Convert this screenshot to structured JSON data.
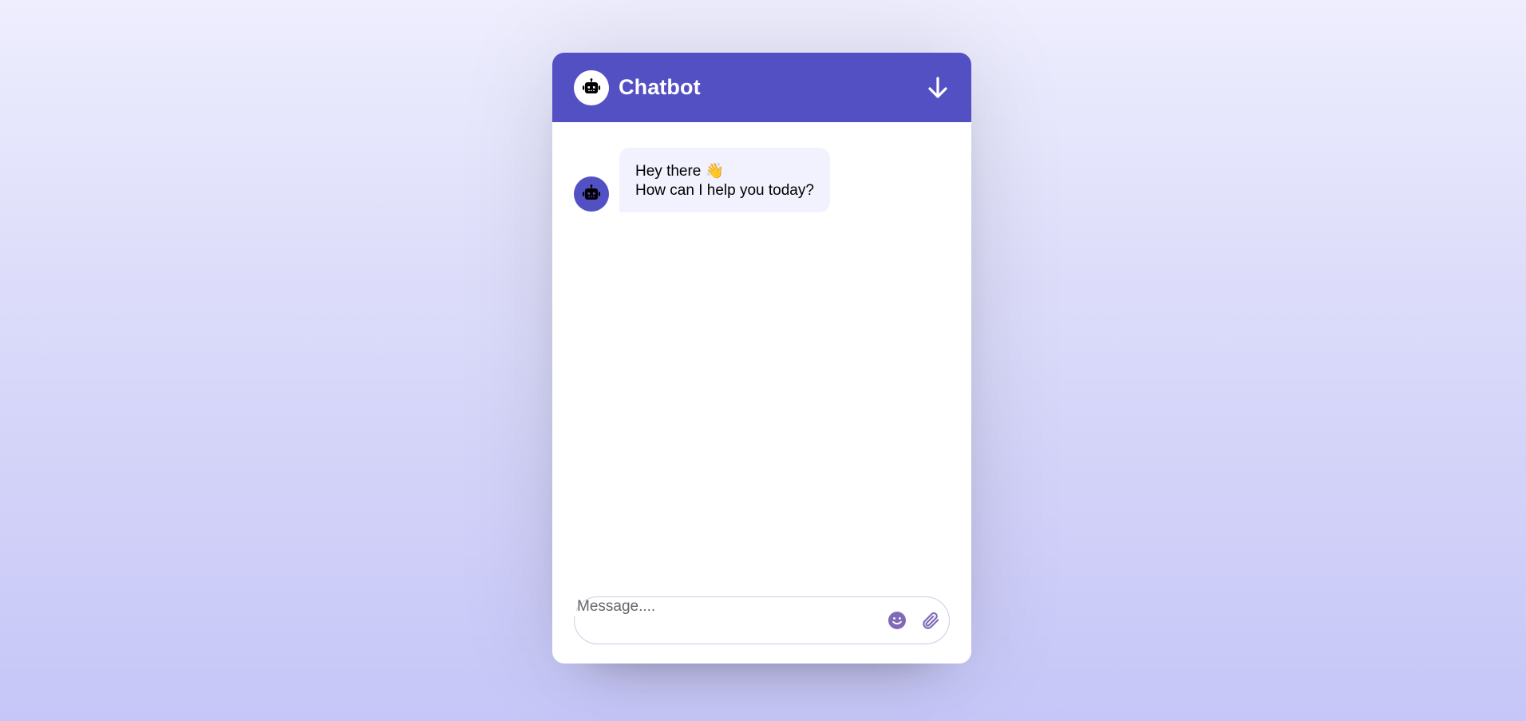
{
  "header": {
    "title": "Chatbot",
    "logo_icon": "robot-icon",
    "collapse_icon": "arrow-down-icon"
  },
  "messages": [
    {
      "sender": "bot",
      "avatar_icon": "robot-icon",
      "lines": [
        "Hey there 👋",
        "How can I help you today?"
      ]
    }
  ],
  "composer": {
    "placeholder": "Message....",
    "value": "",
    "emoji_icon": "smiley-icon",
    "attach_icon": "paperclip-icon"
  },
  "colors": {
    "accent": "#5350c4",
    "bubble_bg": "#f2f2ff",
    "icon_purple": "#806ab8"
  }
}
